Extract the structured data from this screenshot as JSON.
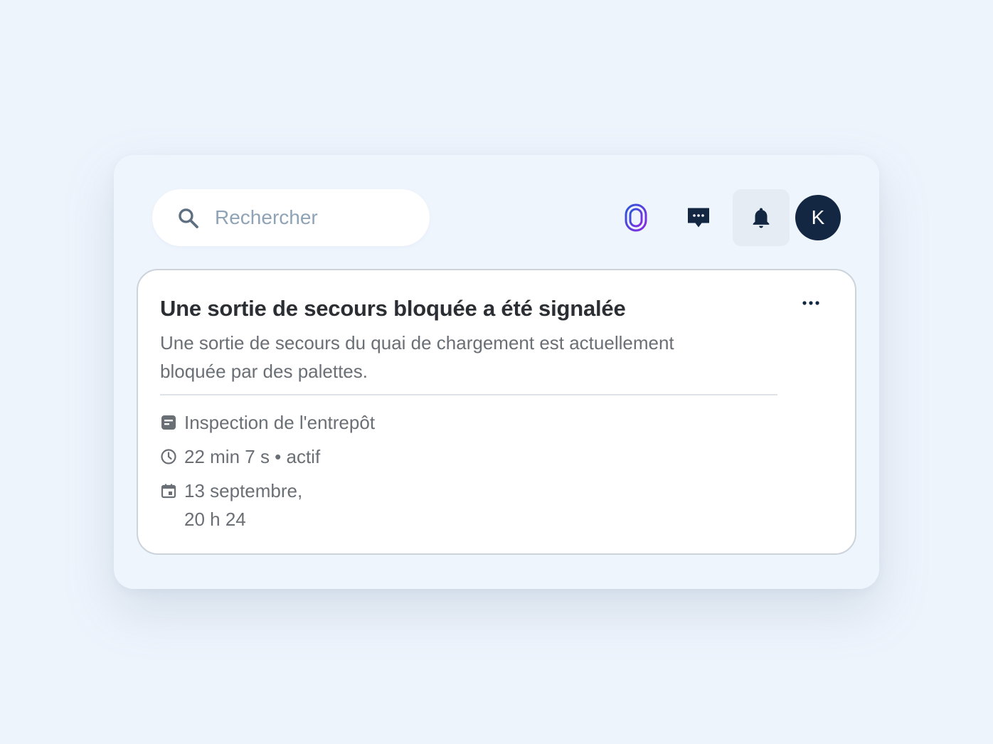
{
  "search": {
    "placeholder": "Rechercher",
    "value": ""
  },
  "toolbar": {
    "brand_icon": "fingerprint-logo-icon",
    "chat_icon": "chat-bubble-icon",
    "bell_icon": "notification-bell-icon"
  },
  "user": {
    "avatar_initial": "K"
  },
  "notification": {
    "title": "Une sortie de secours bloquée a été signalée",
    "description": "Une sortie de secours du quai de chargement est actuellement bloquée par des palettes.",
    "source": "Inspection de l'entrepôt",
    "duration": "22 min 7 s • actif",
    "date": "13 septembre,\n20 h 24",
    "icons": {
      "source": "note-icon",
      "duration": "clock-icon",
      "date": "calendar-icon",
      "more": "more-horizontal-icon"
    }
  },
  "colors": {
    "page_bg": "#eef4fc",
    "panel_bg": "#eff5fd",
    "avatar_bg": "#132742",
    "bell_active_bg": "#e5ecf4",
    "brand_gradient": [
      "#2b56d9",
      "#8a2be2"
    ]
  }
}
